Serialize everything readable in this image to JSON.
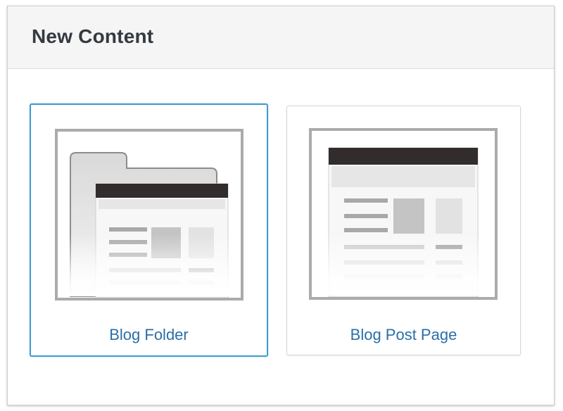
{
  "dialog": {
    "title": "New Content"
  },
  "options": [
    {
      "label": "Blog Folder",
      "icon": "blog-folder-thumbnail",
      "selected": true
    },
    {
      "label": "Blog Post Page",
      "icon": "blog-post-page-thumbnail",
      "selected": false
    }
  ],
  "colors": {
    "accent": "#3e9bcf",
    "link": "#2b6ea8",
    "title": "#333a40",
    "header_bg": "#f5f5f5",
    "page_bar": "#332c2c"
  }
}
